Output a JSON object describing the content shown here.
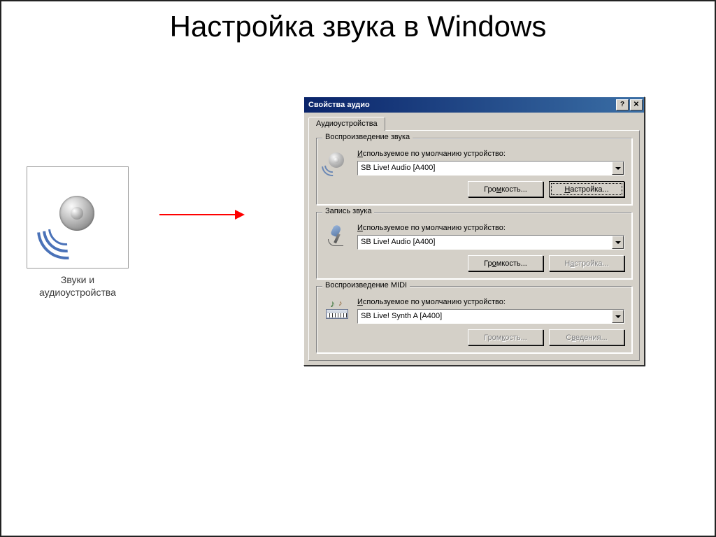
{
  "slide": {
    "title": "Настройка звука в Windows"
  },
  "cp_icon": {
    "caption": "Звуки и аудиоустройства"
  },
  "dialog": {
    "title": "Свойства аудио",
    "help_btn": "?",
    "close_btn": "✕",
    "tab": "Аудиоустройства",
    "groups": {
      "playback": {
        "legend": "Воспроизведение звука",
        "label_pre": "И",
        "label_rest": "спользуемое по умолчанию устройство:",
        "device": "SB Live! Audio [A400]",
        "btn_vol_pre": "Гро",
        "btn_vol_u": "м",
        "btn_vol_post": "кость...",
        "btn_cfg_u": "Н",
        "btn_cfg_post": "астройка..."
      },
      "record": {
        "legend": "Запись звука",
        "label_pre": "И",
        "label_rest": "спользуемое по умолчанию устройство:",
        "device": "SB Live! Audio [A400]",
        "btn_vol_pre": "Гр",
        "btn_vol_u": "о",
        "btn_vol_post": "мкость...",
        "btn_cfg_pre": "Н",
        "btn_cfg_u": "а",
        "btn_cfg_post": "стройка..."
      },
      "midi": {
        "legend": "Воспроизведение MIDI",
        "label_pre": "И",
        "label_rest": "спользуемое по умолчанию устройство:",
        "device": "SB Live! Synth A [A400]",
        "btn_vol_pre": "Гром",
        "btn_vol_u": "к",
        "btn_vol_post": "ость...",
        "btn_info_pre": "С",
        "btn_info_u": "в",
        "btn_info_post": "едения..."
      }
    }
  }
}
